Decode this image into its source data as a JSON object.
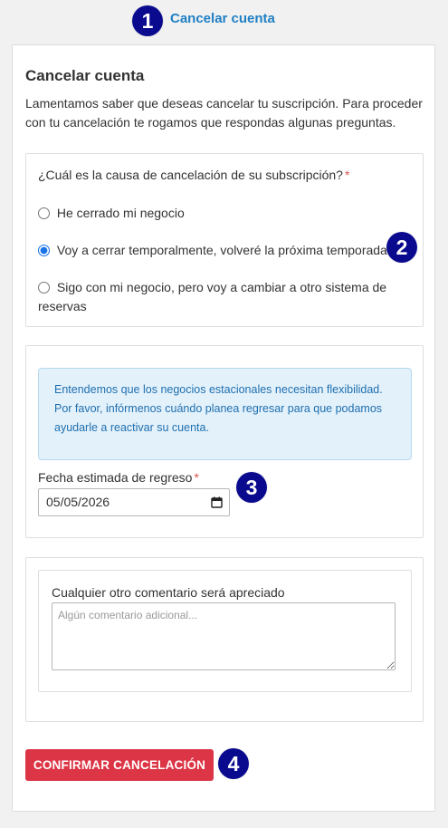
{
  "header": {
    "link_label": "Cancelar cuenta"
  },
  "badges": [
    "1",
    "2",
    "3",
    "4"
  ],
  "card": {
    "title": "Cancelar cuenta",
    "intro": "Lamentamos saber que deseas cancelar tu suscripción. Para proceder con tu cancelación te rogamos que respondas algunas preguntas."
  },
  "reason": {
    "question": "¿Cuál es la causa de cancelación de su subscripción?",
    "required_mark": "*",
    "options": [
      {
        "label": "He cerrado mi negocio",
        "selected": false
      },
      {
        "label": "Voy a cerrar temporalmente, volveré la próxima temporada",
        "selected": true
      },
      {
        "label": "Sigo con mi negocio, pero voy a cambiar a otro sistema de reservas",
        "selected": false
      }
    ]
  },
  "return_date": {
    "info": "Entendemos que los negocios estacionales necesitan flexibilidad. Por favor, infórmenos cuándo planea regresar para que podamos ayudarle a reactivar su cuenta.",
    "label": "Fecha estimada de regreso",
    "required_mark": "*",
    "value": "05/05/2026",
    "icon": "calendar-icon"
  },
  "comments": {
    "label": "Cualquier otro comentario será apreciado",
    "placeholder": "Algún comentario adicional..."
  },
  "confirm_button": {
    "label": "CONFIRMAR CANCELACIÓN"
  },
  "colors": {
    "badge": "#0a0a8f",
    "link": "#1f7fc4",
    "danger": "#dc3545",
    "info_bg": "#e3f1fb",
    "info_text": "#1f6fae",
    "required": "#d9534f"
  }
}
